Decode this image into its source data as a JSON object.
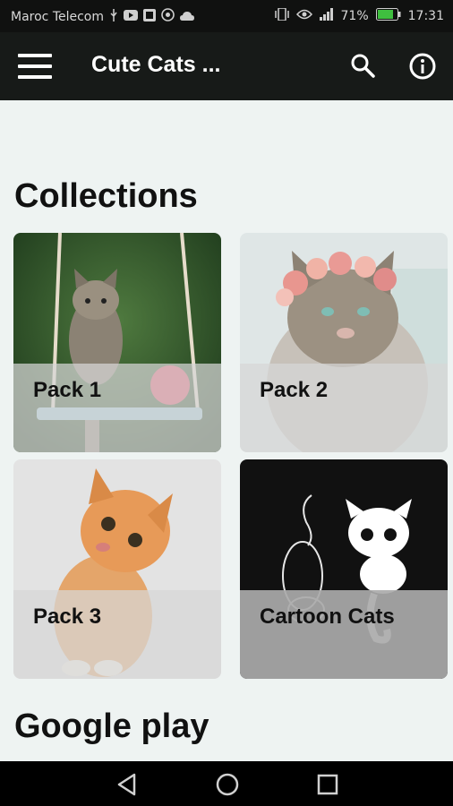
{
  "status_bar": {
    "carrier": "Maroc Telecom",
    "battery": "71%",
    "time": "17:31",
    "icons": [
      "usb-icon",
      "youtube-icon",
      "gallery-icon",
      "whatsapp-icon",
      "cloud-icon",
      "vibrate-icon",
      "eye-icon",
      "signal-icon",
      "battery-icon"
    ]
  },
  "app_bar": {
    "title": "Cute Cats ...",
    "icons": [
      "menu-icon",
      "search-icon",
      "info-icon"
    ]
  },
  "sections": {
    "collections": "Collections",
    "google_play": "Google play"
  },
  "collections": [
    {
      "label": "Pack 1",
      "image": "kitten-on-swing"
    },
    {
      "label": "Pack 2",
      "image": "cat-with-flower-crown"
    },
    {
      "label": "Pack 3",
      "image": "ginger-kitten"
    },
    {
      "label": "Cartoon Cats",
      "image": "cartoon-cats-drawing"
    }
  ],
  "colors": {
    "app_bar": "#171a18",
    "background": "#eef3f2",
    "status_bar": "#101110",
    "nav_bar": "#000000"
  },
  "nav_bar": {
    "icons": [
      "back-icon",
      "home-icon",
      "recents-icon"
    ]
  }
}
